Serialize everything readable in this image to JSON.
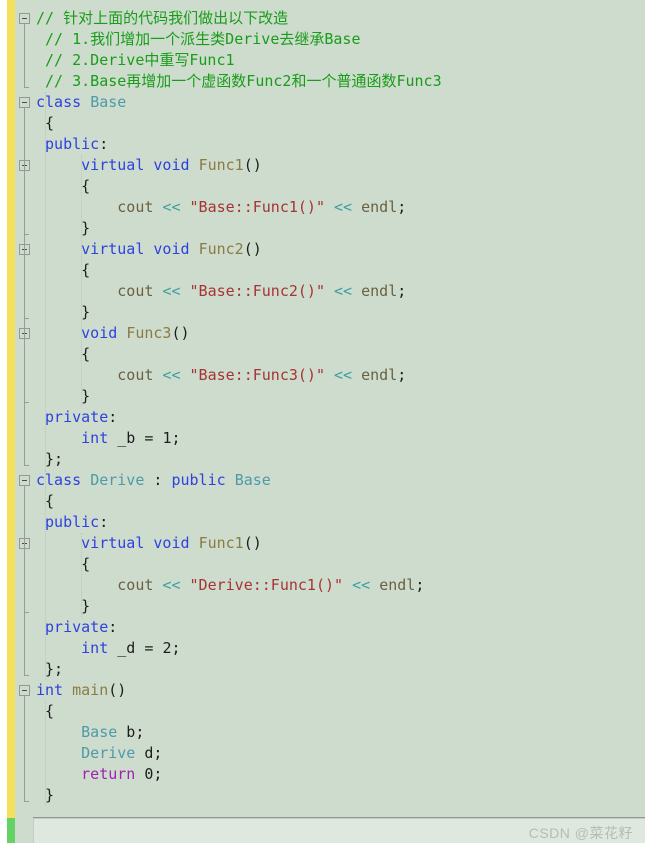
{
  "editor": {
    "title": "C++ code editor",
    "background_color": "#cddccd",
    "font_size_px": 15,
    "line_height_px": 21,
    "gutter": {
      "change_bar_modified_color": "#f5e05a",
      "change_bar_saved_color": "#64d264",
      "fold_marker_symbol": "−"
    },
    "colors": {
      "comment": "#1a9c1a",
      "keyword": "#2f41df",
      "control_keyword": "#a020b0",
      "type_name": "#4e9aa8",
      "function_name": "#8a7b43",
      "string": "#a63434",
      "operator": "#3f9e9e",
      "identifier": "#6b6142",
      "plain": "#1d1d1d"
    }
  },
  "watermark": {
    "text": "CSDN @菜花籽"
  },
  "code": {
    "language": "cpp",
    "lines": [
      {
        "n": 1,
        "fold": "start",
        "tokens": [
          {
            "t": "// 针对上面的代码我们做出以下改造",
            "c": "cmt"
          }
        ]
      },
      {
        "n": 2,
        "tokens": [
          {
            "t": " ",
            "c": "pl"
          },
          {
            "t": "// 1.我们增加一个派生类Derive去继承Base",
            "c": "cmt"
          }
        ]
      },
      {
        "n": 3,
        "tokens": [
          {
            "t": " ",
            "c": "pl"
          },
          {
            "t": "// 2.Derive中重写Func1",
            "c": "cmt"
          }
        ]
      },
      {
        "n": 4,
        "tokens": [
          {
            "t": " ",
            "c": "pl"
          },
          {
            "t": "// 3.Base再增加一个虚函数Func2和一个普通函数Func3",
            "c": "cmt"
          }
        ]
      },
      {
        "n": 5,
        "fold": "start",
        "tokens": [
          {
            "t": "class",
            "c": "kw"
          },
          {
            "t": " ",
            "c": "pl"
          },
          {
            "t": "Base",
            "c": "type"
          }
        ]
      },
      {
        "n": 6,
        "tokens": [
          {
            "t": " {",
            "c": "pl"
          }
        ]
      },
      {
        "n": 7,
        "tokens": [
          {
            "t": " ",
            "c": "pl"
          },
          {
            "t": "public",
            "c": "kw"
          },
          {
            "t": ":",
            "c": "pl"
          }
        ]
      },
      {
        "n": 8,
        "fold": "start",
        "tokens": [
          {
            "t": "     ",
            "c": "pl"
          },
          {
            "t": "virtual",
            "c": "kw"
          },
          {
            "t": " ",
            "c": "pl"
          },
          {
            "t": "void",
            "c": "kw"
          },
          {
            "t": " ",
            "c": "pl"
          },
          {
            "t": "Func1",
            "c": "fn"
          },
          {
            "t": "()",
            "c": "pl"
          }
        ]
      },
      {
        "n": 9,
        "tokens": [
          {
            "t": "     {",
            "c": "pl"
          }
        ]
      },
      {
        "n": 10,
        "tokens": [
          {
            "t": "         ",
            "c": "pl"
          },
          {
            "t": "cout",
            "c": "id"
          },
          {
            "t": " ",
            "c": "pl"
          },
          {
            "t": "<<",
            "c": "op"
          },
          {
            "t": " ",
            "c": "pl"
          },
          {
            "t": "\"Base::Func1()\"",
            "c": "str"
          },
          {
            "t": " ",
            "c": "pl"
          },
          {
            "t": "<<",
            "c": "op"
          },
          {
            "t": " ",
            "c": "pl"
          },
          {
            "t": "endl",
            "c": "id"
          },
          {
            "t": ";",
            "c": "pl"
          }
        ]
      },
      {
        "n": 11,
        "tokens": [
          {
            "t": "     }",
            "c": "pl"
          }
        ]
      },
      {
        "n": 12,
        "fold": "start",
        "tokens": [
          {
            "t": "     ",
            "c": "pl"
          },
          {
            "t": "virtual",
            "c": "kw"
          },
          {
            "t": " ",
            "c": "pl"
          },
          {
            "t": "void",
            "c": "kw"
          },
          {
            "t": " ",
            "c": "pl"
          },
          {
            "t": "Func2",
            "c": "fn"
          },
          {
            "t": "()",
            "c": "pl"
          }
        ]
      },
      {
        "n": 13,
        "tokens": [
          {
            "t": "     {",
            "c": "pl"
          }
        ]
      },
      {
        "n": 14,
        "tokens": [
          {
            "t": "         ",
            "c": "pl"
          },
          {
            "t": "cout",
            "c": "id"
          },
          {
            "t": " ",
            "c": "pl"
          },
          {
            "t": "<<",
            "c": "op"
          },
          {
            "t": " ",
            "c": "pl"
          },
          {
            "t": "\"Base::Func2()\"",
            "c": "str"
          },
          {
            "t": " ",
            "c": "pl"
          },
          {
            "t": "<<",
            "c": "op"
          },
          {
            "t": " ",
            "c": "pl"
          },
          {
            "t": "endl",
            "c": "id"
          },
          {
            "t": ";",
            "c": "pl"
          }
        ]
      },
      {
        "n": 15,
        "tokens": [
          {
            "t": "     }",
            "c": "pl"
          }
        ]
      },
      {
        "n": 16,
        "fold": "start",
        "tokens": [
          {
            "t": "     ",
            "c": "pl"
          },
          {
            "t": "void",
            "c": "kw"
          },
          {
            "t": " ",
            "c": "pl"
          },
          {
            "t": "Func3",
            "c": "fn"
          },
          {
            "t": "()",
            "c": "pl"
          }
        ]
      },
      {
        "n": 17,
        "tokens": [
          {
            "t": "     {",
            "c": "pl"
          }
        ]
      },
      {
        "n": 18,
        "tokens": [
          {
            "t": "         ",
            "c": "pl"
          },
          {
            "t": "cout",
            "c": "id"
          },
          {
            "t": " ",
            "c": "pl"
          },
          {
            "t": "<<",
            "c": "op"
          },
          {
            "t": " ",
            "c": "pl"
          },
          {
            "t": "\"Base::Func3()\"",
            "c": "str"
          },
          {
            "t": " ",
            "c": "pl"
          },
          {
            "t": "<<",
            "c": "op"
          },
          {
            "t": " ",
            "c": "pl"
          },
          {
            "t": "endl",
            "c": "id"
          },
          {
            "t": ";",
            "c": "pl"
          }
        ]
      },
      {
        "n": 19,
        "tokens": [
          {
            "t": "     }",
            "c": "pl"
          }
        ]
      },
      {
        "n": 20,
        "tokens": [
          {
            "t": " ",
            "c": "pl"
          },
          {
            "t": "private",
            "c": "kw"
          },
          {
            "t": ":",
            "c": "pl"
          }
        ]
      },
      {
        "n": 21,
        "tokens": [
          {
            "t": "     ",
            "c": "pl"
          },
          {
            "t": "int",
            "c": "kw"
          },
          {
            "t": " ",
            "c": "pl"
          },
          {
            "t": "_b",
            "c": "pl"
          },
          {
            "t": " = ",
            "c": "pl"
          },
          {
            "t": "1",
            "c": "num"
          },
          {
            "t": ";",
            "c": "pl"
          }
        ]
      },
      {
        "n": 22,
        "tokens": [
          {
            "t": " };",
            "c": "pl"
          }
        ]
      },
      {
        "n": 23,
        "fold": "start",
        "tokens": [
          {
            "t": "class",
            "c": "kw"
          },
          {
            "t": " ",
            "c": "pl"
          },
          {
            "t": "Derive",
            "c": "type"
          },
          {
            "t": " : ",
            "c": "pl"
          },
          {
            "t": "public",
            "c": "kw"
          },
          {
            "t": " ",
            "c": "pl"
          },
          {
            "t": "Base",
            "c": "type"
          }
        ]
      },
      {
        "n": 24,
        "tokens": [
          {
            "t": " {",
            "c": "pl"
          }
        ]
      },
      {
        "n": 25,
        "tokens": [
          {
            "t": " ",
            "c": "pl"
          },
          {
            "t": "public",
            "c": "kw"
          },
          {
            "t": ":",
            "c": "pl"
          }
        ]
      },
      {
        "n": 26,
        "fold": "start",
        "tokens": [
          {
            "t": "     ",
            "c": "pl"
          },
          {
            "t": "virtual",
            "c": "kw"
          },
          {
            "t": " ",
            "c": "pl"
          },
          {
            "t": "void",
            "c": "kw"
          },
          {
            "t": " ",
            "c": "pl"
          },
          {
            "t": "Func1",
            "c": "fn"
          },
          {
            "t": "()",
            "c": "pl"
          }
        ]
      },
      {
        "n": 27,
        "tokens": [
          {
            "t": "     {",
            "c": "pl"
          }
        ]
      },
      {
        "n": 28,
        "tokens": [
          {
            "t": "         ",
            "c": "pl"
          },
          {
            "t": "cout",
            "c": "id"
          },
          {
            "t": " ",
            "c": "pl"
          },
          {
            "t": "<<",
            "c": "op"
          },
          {
            "t": " ",
            "c": "pl"
          },
          {
            "t": "\"Derive::Func1()\"",
            "c": "str"
          },
          {
            "t": " ",
            "c": "pl"
          },
          {
            "t": "<<",
            "c": "op"
          },
          {
            "t": " ",
            "c": "pl"
          },
          {
            "t": "endl",
            "c": "id"
          },
          {
            "t": ";",
            "c": "pl"
          }
        ]
      },
      {
        "n": 29,
        "tokens": [
          {
            "t": "     }",
            "c": "pl"
          }
        ]
      },
      {
        "n": 30,
        "tokens": [
          {
            "t": " ",
            "c": "pl"
          },
          {
            "t": "private",
            "c": "kw"
          },
          {
            "t": ":",
            "c": "pl"
          }
        ]
      },
      {
        "n": 31,
        "tokens": [
          {
            "t": "     ",
            "c": "pl"
          },
          {
            "t": "int",
            "c": "kw"
          },
          {
            "t": " ",
            "c": "pl"
          },
          {
            "t": "_d",
            "c": "pl"
          },
          {
            "t": " = ",
            "c": "pl"
          },
          {
            "t": "2",
            "c": "num"
          },
          {
            "t": ";",
            "c": "pl"
          }
        ]
      },
      {
        "n": 32,
        "tokens": [
          {
            "t": " };",
            "c": "pl"
          }
        ]
      },
      {
        "n": 33,
        "fold": "start",
        "tokens": [
          {
            "t": "int",
            "c": "kw"
          },
          {
            "t": " ",
            "c": "pl"
          },
          {
            "t": "main",
            "c": "fn"
          },
          {
            "t": "()",
            "c": "pl"
          }
        ]
      },
      {
        "n": 34,
        "tokens": [
          {
            "t": " {",
            "c": "pl"
          }
        ]
      },
      {
        "n": 35,
        "tokens": [
          {
            "t": "     ",
            "c": "pl"
          },
          {
            "t": "Base",
            "c": "type"
          },
          {
            "t": " b;",
            "c": "pl"
          }
        ]
      },
      {
        "n": 36,
        "tokens": [
          {
            "t": "     ",
            "c": "pl"
          },
          {
            "t": "Derive",
            "c": "type"
          },
          {
            "t": " d;",
            "c": "pl"
          }
        ]
      },
      {
        "n": 37,
        "tokens": [
          {
            "t": "     ",
            "c": "pl"
          },
          {
            "t": "return",
            "c": "kw2"
          },
          {
            "t": " ",
            "c": "pl"
          },
          {
            "t": "0",
            "c": "num"
          },
          {
            "t": ";",
            "c": "pl"
          }
        ]
      },
      {
        "n": 38,
        "tokens": [
          {
            "t": " }",
            "c": "pl"
          }
        ]
      }
    ]
  }
}
